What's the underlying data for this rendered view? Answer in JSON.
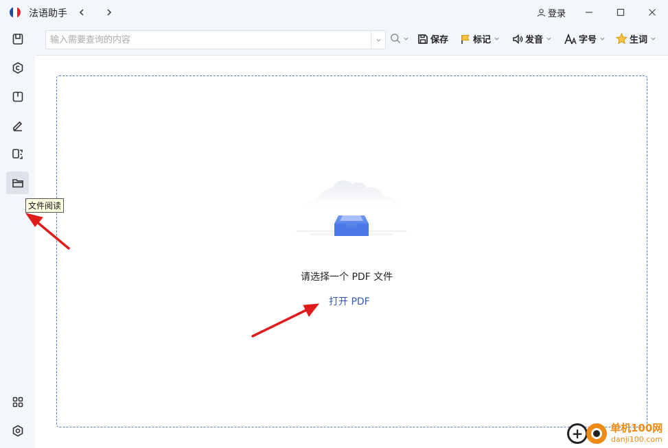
{
  "app": {
    "title": "法语助手"
  },
  "header": {
    "login_label": "登录"
  },
  "sidebar": {
    "items": [
      {
        "name": "sidebar-item-dictionary",
        "icon": "book-icon"
      },
      {
        "name": "sidebar-item-conjugation",
        "icon": "c-circle-icon"
      },
      {
        "name": "sidebar-item-notebook",
        "icon": "notebook-icon"
      },
      {
        "name": "sidebar-item-edit",
        "icon": "pen-icon"
      },
      {
        "name": "sidebar-item-translate",
        "icon": "scan-icon"
      },
      {
        "name": "sidebar-item-file-reading",
        "icon": "folder-icon"
      }
    ],
    "bottom": [
      {
        "name": "sidebar-item-apps",
        "icon": "grid-icon"
      },
      {
        "name": "sidebar-item-settings",
        "icon": "gear-icon"
      }
    ]
  },
  "tooltip": {
    "text": "文件阅读"
  },
  "toolbar": {
    "search_placeholder": "输入需要查询的内容",
    "save_label": "保存",
    "mark_label": "标记",
    "sound_label": "发音",
    "font_label": "字号",
    "vocab_label": "生词"
  },
  "main": {
    "prompt": "请选择一个 PDF 文件",
    "open_link": "打开 PDF"
  },
  "watermark": {
    "brand": "单机100网",
    "url": "danji100.com"
  },
  "colors": {
    "accent": "#3558b5",
    "sidebar_bg": "#f3f6fb",
    "arrow": "#e01b1b",
    "watermark": "#f08a17"
  }
}
